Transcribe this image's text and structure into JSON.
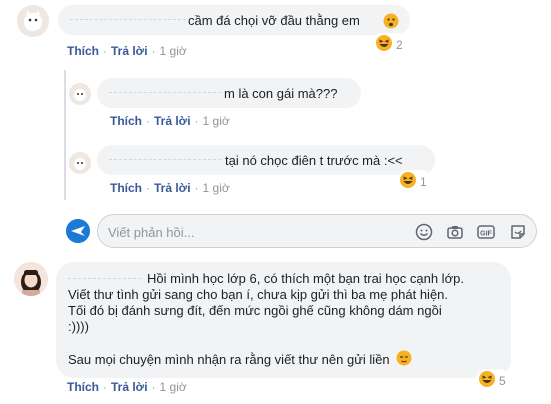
{
  "comments": [
    {
      "text": "cầm đá chọi vỡ đầu thằng em",
      "actions": {
        "like": "Thích",
        "reply": "Trả lời",
        "time": "1 giờ"
      },
      "reaction": {
        "icon": "haha-emoji-icon",
        "count": "2"
      }
    }
  ],
  "replies": [
    {
      "text": "m là con gái mà???",
      "actions": {
        "like": "Thích",
        "reply": "Trả lời",
        "time": "1 giờ"
      }
    },
    {
      "text": "tại nó chọc điên t trước mà :<<",
      "actions": {
        "like": "Thích",
        "reply": "Trả lời",
        "time": "1 giờ"
      },
      "reaction": {
        "icon": "haha-emoji-icon",
        "count": "1"
      }
    }
  ],
  "composer": {
    "placeholder": "Viết phản hồi...",
    "icons": [
      "emoji-icon",
      "camera-icon",
      "gif-icon",
      "sticker-icon"
    ]
  },
  "comment2": {
    "lines": [
      "Hồi mình học lớp 6, có thích một bạn trai học cạnh lớp.",
      "Viết thư tình gửi sang cho bạn í, chưa kịp gửi thì ba mẹ phát hiện.",
      "Tối đó bị đánh sưng đít, đến mức ngồi ghế cũng không dám ngồi",
      ":))))"
    ],
    "last_line": "Sau mọi chuyện mình nhận ra rằng viết thư nên gửi liền",
    "actions": {
      "like": "Thích",
      "reply": "Trả lời",
      "time": "1 giờ"
    },
    "reaction": {
      "icon": "haha-emoji-icon",
      "count": "5"
    }
  },
  "colors": {
    "bubble": "#f2f3f5",
    "link": "#4b4f56",
    "meta": "#90949c",
    "emoji": "#f7b125"
  }
}
